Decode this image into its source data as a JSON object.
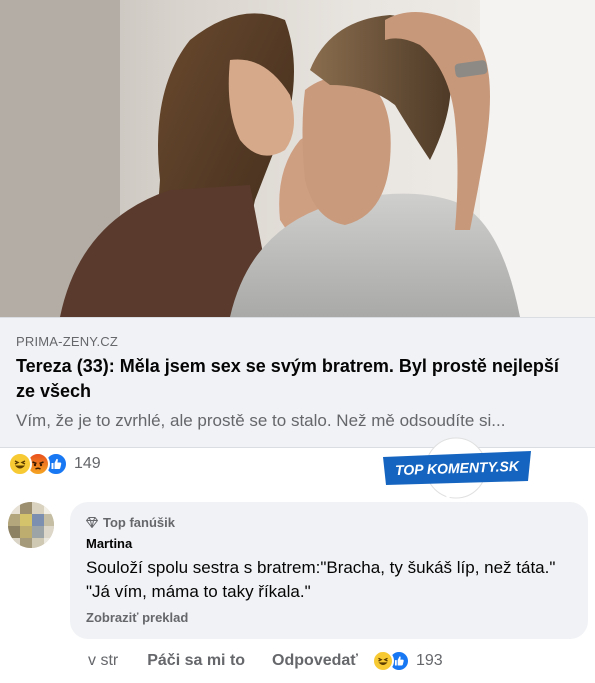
{
  "post": {
    "image_alt": "couple kissing photo",
    "link": {
      "domain": "PRIMA-ZENY.CZ",
      "title": "Tereza (33): Měla jsem sex se svým bratrem. Byl prostě nejlepší ze všech",
      "description": "Vím, že je to zvrhlé, ale prostě se to stalo. Než mě odsoudíte si..."
    },
    "reactions": {
      "icons": [
        "haha-icon",
        "angry-icon",
        "like-icon"
      ],
      "count": "149"
    }
  },
  "badge": {
    "text": "TOP KOMENTY.SK",
    "color": "#1565c0"
  },
  "comment": {
    "avatar": "pixelated-avatar",
    "top_fan_label": "Top fanúšik",
    "author": "Martina",
    "text": "Souloží spolu sestra s bratrem:\"Bracha, ty šukáš líp, než táta.\" \"Já vím, máma to taky říkala.\"",
    "translate_label": "Zobraziť preklad",
    "time": "v str",
    "like_label": "Páči sa mi to",
    "reply_label": "Odpovedať",
    "reaction_icons": [
      "haha-icon",
      "like-icon"
    ],
    "reaction_count": "193"
  },
  "colors": {
    "link_bg": "#f0f2f5",
    "secondary_text": "#65676b",
    "like_blue": "#1877f2"
  }
}
